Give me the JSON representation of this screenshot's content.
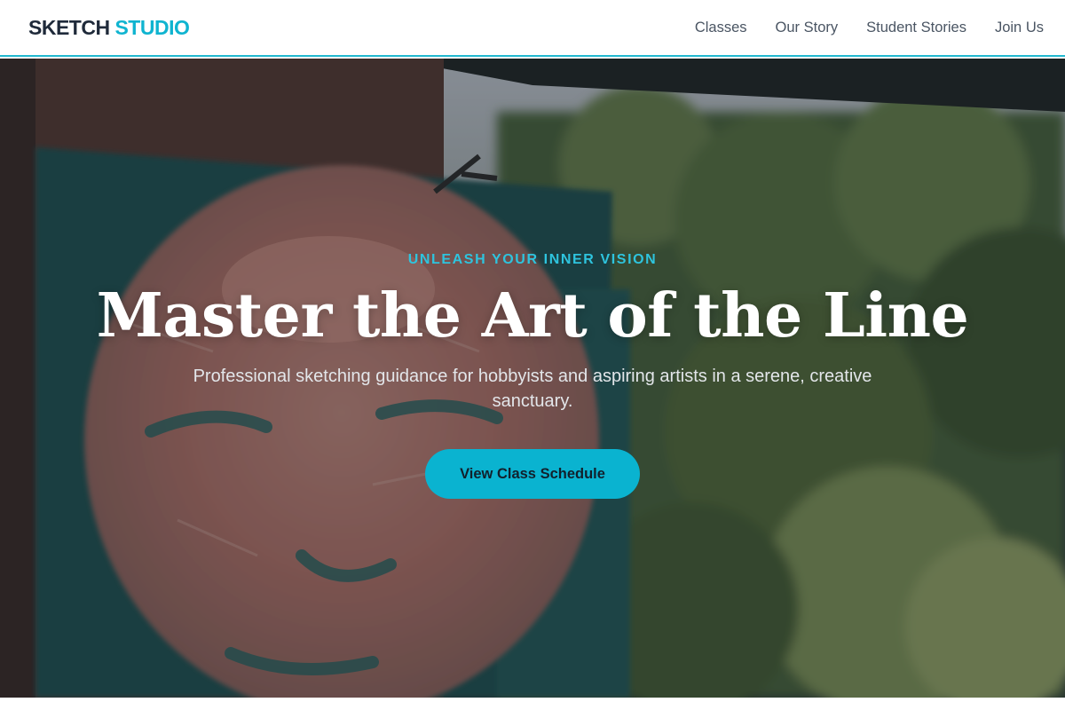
{
  "header": {
    "logo_primary": "SKETCH",
    "logo_accent": "STUDIO",
    "nav": [
      {
        "label": "Classes"
      },
      {
        "label": "Our Story"
      },
      {
        "label": "Student Stories"
      },
      {
        "label": "Join Us"
      }
    ]
  },
  "hero": {
    "eyebrow": "UNLEASH YOUR INNER VISION",
    "title": "Master the Art of the Line",
    "subtitle": "Professional sketching guidance for hobbyists and aspiring artists in a serene, creative sanctuary.",
    "cta_label": "View Class Schedule"
  },
  "colors": {
    "accent": "#0fb4d0",
    "header_border": "#22b8cf",
    "logo_dark": "#1f2a3a",
    "cta_bg": "#0ab3d0"
  }
}
